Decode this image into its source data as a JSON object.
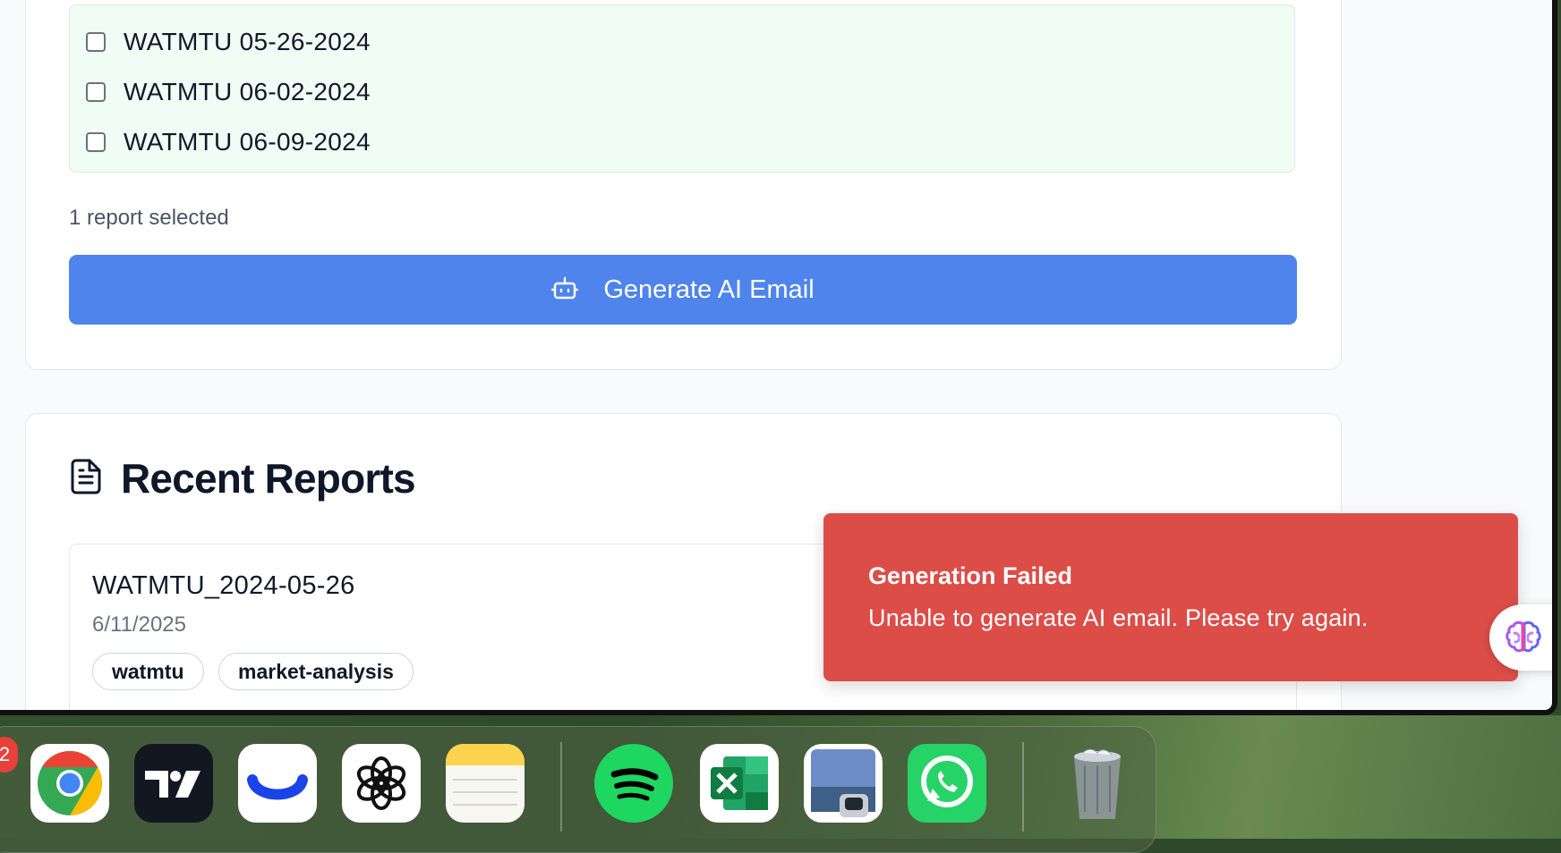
{
  "reports_selector": {
    "items": [
      {
        "label": "WATMTU 05-26-2024",
        "checked": false
      },
      {
        "label": "WATMTU 06-02-2024",
        "checked": false
      },
      {
        "label": "WATMTU 06-09-2024",
        "checked": false
      }
    ],
    "selected_count_text": "1 report selected",
    "generate_button_label": "Generate AI Email",
    "accent_color": "#4f84ec"
  },
  "recent_reports": {
    "title": "Recent Reports",
    "reports": [
      {
        "name": "WATMTU_2024-05-26",
        "date": "6/11/2025",
        "tags": [
          "watmtu",
          "market-analysis"
        ]
      }
    ]
  },
  "toast": {
    "title": "Generation Failed",
    "message": "Unable to generate AI email. Please try again.",
    "color": "#dc4d48"
  },
  "dock": {
    "badge_count": "2",
    "apps": [
      "Chrome",
      "TradingView",
      "Webull",
      "ChatGPT",
      "Notes",
      "Spotify",
      "Excel",
      "Preview",
      "WhatsApp",
      "Trash"
    ]
  }
}
